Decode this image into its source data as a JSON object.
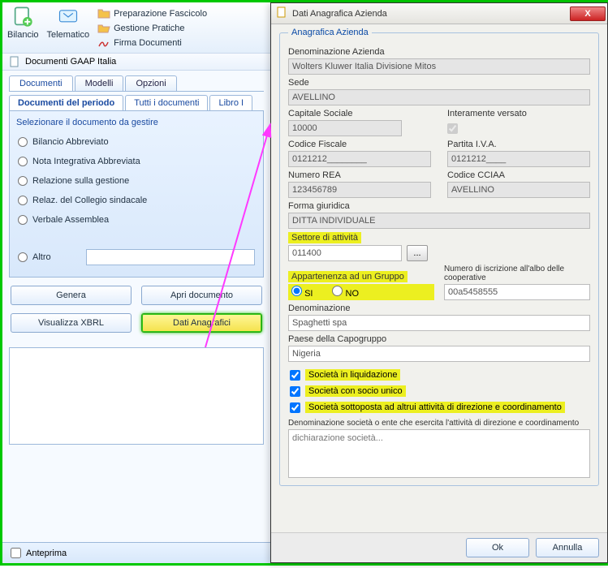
{
  "ribbon": {
    "bilancio": "Bilancio",
    "telematico": "Telematico",
    "links": {
      "prep": "Preparazione Fascicolo",
      "gest": "Gestione Pratiche",
      "firma": "Firma Documenti"
    }
  },
  "docbar": {
    "title": "Documenti GAAP Italia"
  },
  "tabs1": {
    "documenti": "Documenti",
    "modelli": "Modelli",
    "opzioni": "Opzioni"
  },
  "tabs2": {
    "periodo": "Documenti del periodo",
    "tutti": "Tutti i documenti",
    "libro": "Libro I"
  },
  "hint": "Selezionare il documento da gestire",
  "docs": {
    "d1": "Bilancio Abbreviato",
    "d2": "Nota Integrativa Abbreviata",
    "d3": "Relazione sulla gestione",
    "d4": "Relaz. del Collegio sindacale",
    "d5": "Verbale Assemblea",
    "altro": "Altro"
  },
  "buttons": {
    "genera": "Genera",
    "apri": "Apri documento",
    "xbrl": "Visualizza XBRL",
    "anagrafici": "Dati Anagrafici",
    "anteprima": "Anteprima"
  },
  "dialog": {
    "title": "Dati Anagrafica Azienda",
    "close": "X",
    "groupTitle": "Anagrafica Azienda",
    "denom_lbl": "Denominazione Azienda",
    "denom_val": "Wolters Kluwer Italia Divisione Mitos",
    "sede_lbl": "Sede",
    "sede_val": "AVELLINO",
    "cap_lbl": "Capitale Sociale",
    "cap_val": "10000",
    "inter_lbl": "Interamente versato",
    "cf_lbl": "Codice Fiscale",
    "cf_val": "0121212________",
    "piva_lbl": "Partita I.V.A.",
    "piva_val": "0121212____",
    "rea_lbl": "Numero REA",
    "rea_val": "123456789",
    "cciaa_lbl": "Codice CCIAA",
    "cciaa_val": "AVELLINO",
    "forma_lbl": "Forma giuridica",
    "forma_val": "DITTA INDIVIDUALE",
    "settore_lbl": "Settore di attività",
    "settore_val": "011400",
    "settore_btn": "...",
    "gruppo_lbl": "Appartenenza ad un Gruppo",
    "si": "SI",
    "no": "NO",
    "coop_lbl": "Numero di iscrizione all'albo delle cooperative",
    "coop_val": "00a5458555",
    "denomg_lbl": "Denominazione",
    "denomg_val": "Spaghetti spa",
    "paese_lbl": "Paese della Capogruppo",
    "paese_val": "Nigeria",
    "chk1": "Società in liquidazione",
    "chk2": "Società con socio unico",
    "chk3": "Società sottoposta ad altrui attività di direzione e coordinamento",
    "denomdir_lbl": "Denominazione società o ente che esercita l'attività di direzione e coordinamento",
    "denomdir_val": "dichiarazione società...",
    "ok": "Ok",
    "annulla": "Annulla"
  }
}
